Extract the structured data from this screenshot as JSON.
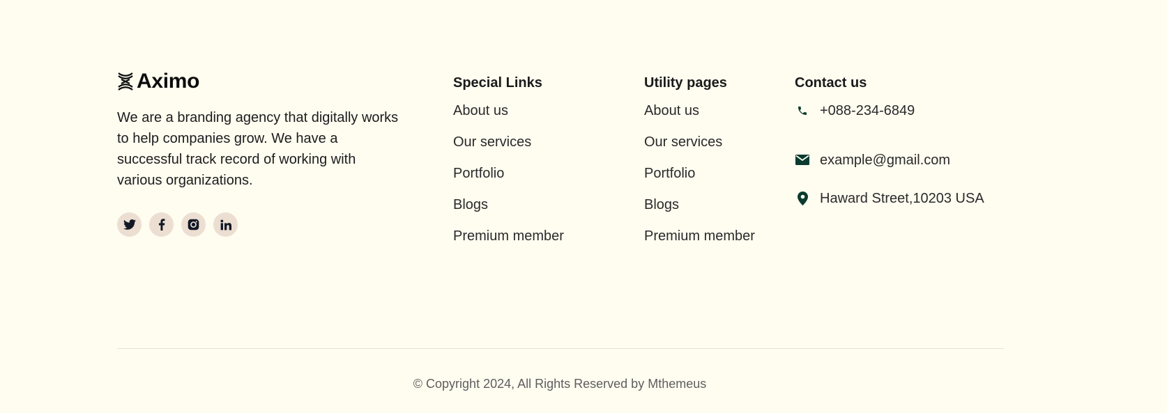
{
  "brand": {
    "name": "Aximo",
    "logo_icon": "aximo-logo-mark",
    "description": "We are a branding agency that digitally works to help companies grow. We have a successful track record of working with various organizations."
  },
  "socials": [
    {
      "icon": "twitter-icon"
    },
    {
      "icon": "facebook-icon"
    },
    {
      "icon": "instagram-icon"
    },
    {
      "icon": "linkedin-icon"
    }
  ],
  "special_links": {
    "title": "Special Links",
    "items": [
      "About us",
      "Our services",
      "Portfolio",
      "Blogs",
      "Premium member"
    ]
  },
  "utility_pages": {
    "title": "Utility pages",
    "items": [
      "About us",
      "Our services",
      "Portfolio",
      "Blogs",
      "Premium member"
    ]
  },
  "contact": {
    "title": "Contact us",
    "phone": "+088-234-6849",
    "email": "example@gmail.com",
    "address": "Haward Street,10203 USA",
    "icon_color": "#0b3b2e"
  },
  "copyright": "© Copyright 2024, All Rights Reserved by Mthemeus",
  "colors": {
    "background": "#fffcf0",
    "social_bg": "#ecdfd2",
    "social_icon": "#121826"
  }
}
